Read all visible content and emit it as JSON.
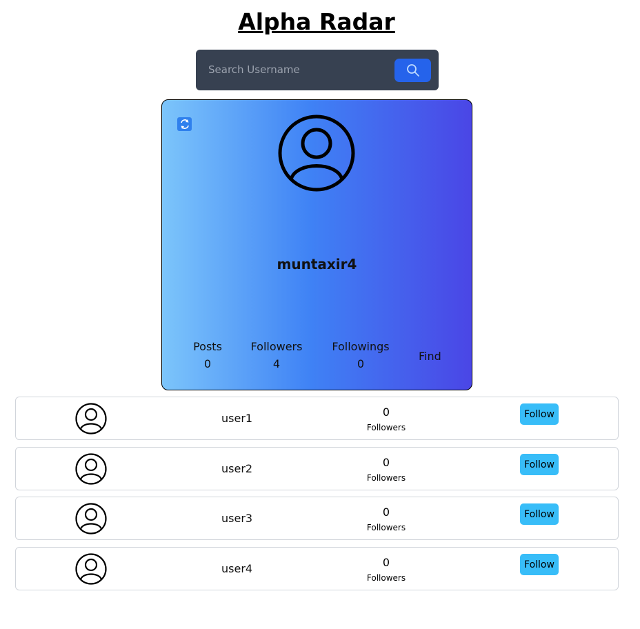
{
  "app": {
    "title": "Alpha Radar"
  },
  "search": {
    "placeholder": "Search Username",
    "icon": "search-icon"
  },
  "profile": {
    "username": "muntaxir4",
    "stats": [
      {
        "label": "Posts",
        "value": "0"
      },
      {
        "label": "Followers",
        "value": "4"
      },
      {
        "label": "Followings",
        "value": "0"
      }
    ],
    "find_label": "Find",
    "refresh_icon": "refresh-icon"
  },
  "users": [
    {
      "name": "user1",
      "followers": "0",
      "followers_label": "Followers",
      "button": "Follow"
    },
    {
      "name": "user2",
      "followers": "0",
      "followers_label": "Followers",
      "button": "Follow"
    },
    {
      "name": "user3",
      "followers": "0",
      "followers_label": "Followers",
      "button": "Follow"
    },
    {
      "name": "user4",
      "followers": "0",
      "followers_label": "Followers",
      "button": "Follow"
    }
  ],
  "colors": {
    "search_bg": "#374151",
    "search_button": "#2563eb",
    "card_gradient_start": "#7cc5fb",
    "card_gradient_end": "#4a46e6",
    "follow_button": "#38bdf8"
  }
}
